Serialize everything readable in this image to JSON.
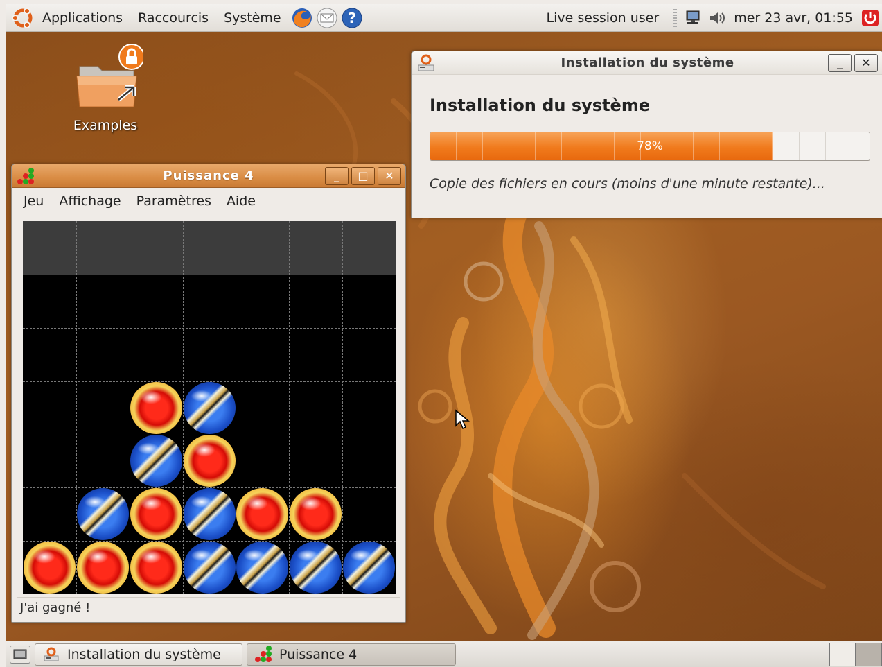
{
  "top_panel": {
    "menus": [
      "Applications",
      "Raccourcis",
      "Système"
    ],
    "launchers": [
      "firefox-icon",
      "mail-icon",
      "help-icon"
    ],
    "user": "Live session user",
    "clock": "mer 23 avr, 01:55"
  },
  "desktop": {
    "icons": [
      {
        "label": "Examples",
        "icon": "folder-icon"
      }
    ]
  },
  "installer_window": {
    "title": "Installation du système",
    "heading": "Installation du système",
    "progress_percent": 78,
    "progress_text": "78%",
    "status": "Copie des fichiers en cours (moins d'une minute restante)..."
  },
  "game_window": {
    "title": "Puissance 4",
    "menus": [
      "Jeu",
      "Affichage",
      "Paramètres",
      "Aide"
    ],
    "status": "J'ai gagné !",
    "board": {
      "columns": 7,
      "rows": 6,
      "pieces": [
        [
          null,
          null,
          null,
          null,
          null,
          null,
          null
        ],
        [
          null,
          null,
          null,
          null,
          null,
          null,
          null
        ],
        [
          null,
          null,
          "red",
          "blue",
          null,
          null,
          null
        ],
        [
          null,
          null,
          "blue",
          "red",
          null,
          null,
          null
        ],
        [
          null,
          "blue",
          "red",
          "blue",
          "red",
          "red",
          null
        ],
        [
          "red",
          "red",
          "red",
          "blue",
          "blue",
          "blue",
          "blue"
        ]
      ]
    }
  },
  "bottom_panel": {
    "tasks": [
      {
        "label": "Installation du système"
      },
      {
        "label": "Puissance 4"
      }
    ]
  },
  "colors": {
    "progress_fill": "#f07a1c",
    "game_titlebar": "#d98c44",
    "wallpaper": "#9b5822"
  }
}
